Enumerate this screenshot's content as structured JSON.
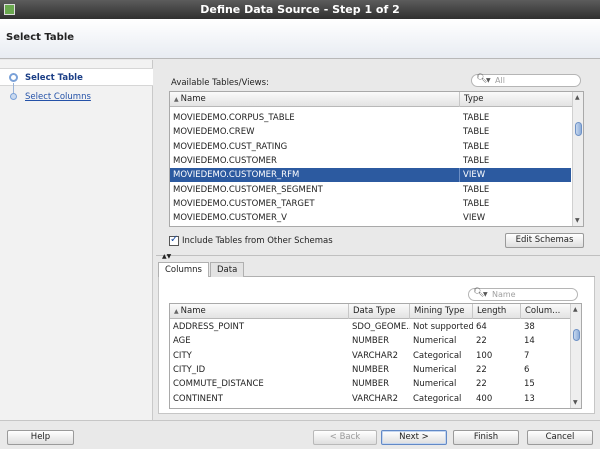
{
  "window": {
    "title": "Define Data Source - Step 1 of 2"
  },
  "header": {
    "page_title": "Select Table"
  },
  "steps": [
    {
      "label": "Select Table",
      "state": "current"
    },
    {
      "label": "Select Columns",
      "state": "link"
    }
  ],
  "tables": {
    "label": "Available Tables/Views:",
    "search_placeholder": "All",
    "columns": [
      "Name",
      "Type"
    ],
    "rows": [
      {
        "name": "MOVIEDEMO.CORPUS_TABLE",
        "type": "TABLE"
      },
      {
        "name": "MOVIEDEMO.CREW",
        "type": "TABLE"
      },
      {
        "name": "MOVIEDEMO.CUST_RATING",
        "type": "TABLE"
      },
      {
        "name": "MOVIEDEMO.CUSTOMER",
        "type": "TABLE"
      },
      {
        "name": "MOVIEDEMO.CUSTOMER_RFM",
        "type": "VIEW"
      },
      {
        "name": "MOVIEDEMO.CUSTOMER_SEGMENT",
        "type": "TABLE"
      },
      {
        "name": "MOVIEDEMO.CUSTOMER_TARGET",
        "type": "TABLE"
      },
      {
        "name": "MOVIEDEMO.CUSTOMER_V",
        "type": "VIEW"
      }
    ],
    "selected_row": "MOVIEDEMO.CUSTOMER_RFM"
  },
  "include_other_schemas": {
    "label": "Include Tables from Other Schemas",
    "checked": true
  },
  "edit_schemas_label": "Edit Schemas",
  "detail_tabs": [
    {
      "label": "Columns",
      "active": true
    },
    {
      "label": "Data",
      "active": false
    }
  ],
  "columns_grid": {
    "search_placeholder": "Name",
    "headers": [
      "Name",
      "Data Type",
      "Mining Type",
      "Length",
      "Colum..."
    ],
    "rows": [
      {
        "name": "ADDRESS_POINT",
        "data_type": "SDO_GEOME...",
        "mining_type": "Not supported",
        "length": "64",
        "column": "38"
      },
      {
        "name": "AGE",
        "data_type": "NUMBER",
        "mining_type": "Numerical",
        "length": "22",
        "column": "14"
      },
      {
        "name": "CITY",
        "data_type": "VARCHAR2",
        "mining_type": "Categorical",
        "length": "100",
        "column": "7"
      },
      {
        "name": "CITY_ID",
        "data_type": "NUMBER",
        "mining_type": "Numerical",
        "length": "22",
        "column": "6"
      },
      {
        "name": "COMMUTE_DISTANCE",
        "data_type": "NUMBER",
        "mining_type": "Numerical",
        "length": "22",
        "column": "15"
      },
      {
        "name": "CONTINENT",
        "data_type": "VARCHAR2",
        "mining_type": "Categorical",
        "length": "400",
        "column": "13"
      }
    ]
  },
  "buttons": {
    "help": "Help",
    "back": "< Back",
    "next": "Next >",
    "finish": "Finish",
    "cancel": "Cancel"
  },
  "colors": {
    "selection": "#2c5aa0",
    "title_bar": "#3a3a3a",
    "link": "#2452a8"
  }
}
